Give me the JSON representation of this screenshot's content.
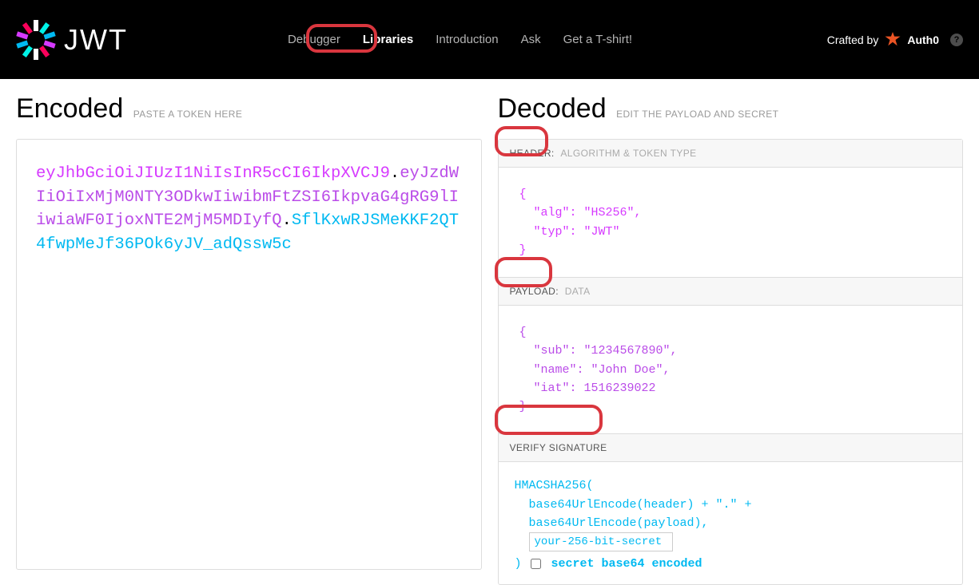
{
  "nav": {
    "brand_text": "JWT",
    "links": [
      "Debugger",
      "Libraries",
      "Introduction",
      "Ask",
      "Get a T-shirt!"
    ],
    "crafted_by": "Crafted by",
    "auth0": "Auth0"
  },
  "encoded": {
    "title": "Encoded",
    "subtitle": "PASTE A TOKEN HERE",
    "token_header": "eyJhbGciOiJIUzI1NiIsInR5cCI6IkpXVCJ9",
    "token_payload": "eyJzdWIiOiIxMjM0NTY3ODkwIiwibmFtZSI6IkpvaG4gRG9lIiwiaWF0IjoxNTE2MjM5MDIyfQ",
    "token_signature": "SflKxwRJSMeKKF2QT4fwpMeJf36POk6yJV_adQssw5c"
  },
  "decoded": {
    "title": "Decoded",
    "subtitle": "EDIT THE PAYLOAD AND SECRET",
    "header_label": "HEADER:",
    "header_sub": "ALGORITHM & TOKEN TYPE",
    "header_json_l1": "{",
    "header_json_l2": "  \"alg\": \"HS256\",",
    "header_json_l3": "  \"typ\": \"JWT\"",
    "header_json_l4": "}",
    "payload_label": "PAYLOAD:",
    "payload_sub": "DATA",
    "payload_json_l1": "{",
    "payload_json_l2": "  \"sub\": \"1234567890\",",
    "payload_json_l3": "  \"name\": \"John Doe\",",
    "payload_json_l4": "  \"iat\": 1516239022",
    "payload_json_l5": "}",
    "sig_label": "VERIFY SIGNATURE",
    "sig_l1": "HMACSHA256(",
    "sig_l2": "  base64UrlEncode(header) + \".\" +",
    "sig_l3": "  base64UrlEncode(payload),",
    "sig_l4_close": ") ",
    "secret_value": "your-256-bit-secret",
    "b64_label": "secret base64 encoded"
  }
}
